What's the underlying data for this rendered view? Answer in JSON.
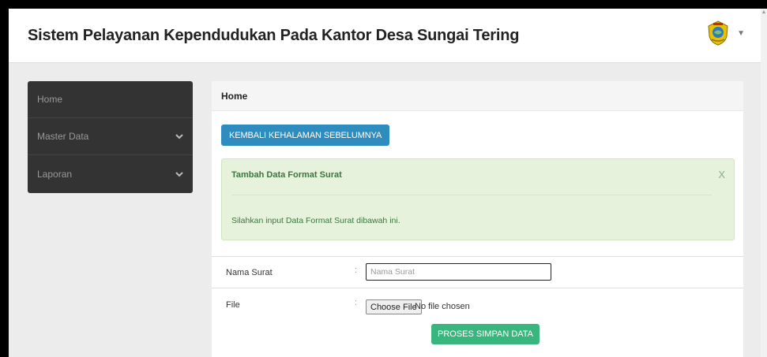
{
  "header": {
    "title": "Sistem Pelayanan Kependudukan Pada Kantor Desa Sungai Tering",
    "avatar_icon": "emblem-logo",
    "menu_icon": "caret-down-icon"
  },
  "sidebar": {
    "items": [
      {
        "label": "Home",
        "has_children": false
      },
      {
        "label": "Master Data",
        "has_children": true
      },
      {
        "label": "Laporan",
        "has_children": true
      }
    ]
  },
  "panel": {
    "heading": "Home",
    "back_button": "KEMBALI KEHALAMAN SEBELUMNYA",
    "alert": {
      "title": "Tambah Data Format Surat",
      "close": "X",
      "message": "Silahkan input Data Format Surat dibawah ini."
    },
    "form": {
      "nama_label": "Nama Surat",
      "colon": ":",
      "nama_placeholder": "Nama Surat",
      "file_label": "File",
      "file_button": "Choose File",
      "file_status": "No file chosen",
      "submit": "PROSES SIMPAN DATA"
    }
  },
  "colors": {
    "sidebar_bg": "#333333",
    "primary": "#2f8cbf",
    "success": "#39b67d",
    "alert_bg": "#e6f2dc"
  }
}
